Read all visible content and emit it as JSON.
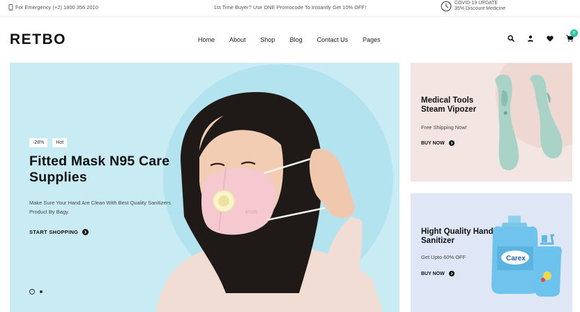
{
  "topbar": {
    "emergency": "For Emergency (+2) 1800 356 2010",
    "promo": "1st Time Buyer? Use ONE Promocode To Instantly Get 10% OFF!",
    "covid_title": "COVID-19 UPDATE",
    "covid_sub": "35% Discount Medicine"
  },
  "header": {
    "logo": "RETBO",
    "nav": [
      "Home",
      "About",
      "Shop",
      "Blog",
      "Contact Us",
      "Pages"
    ],
    "cart_count": "0",
    "icons": [
      "search-icon",
      "user-icon",
      "heart-icon",
      "cart-icon"
    ]
  },
  "hero": {
    "badge_discount": "-28%",
    "badge_hot": "Hot",
    "title": "Fitted Mask N95 Care Supplies",
    "description": "Make Sure Your Hand Are Clean With Best Quality Sanitizers Product By Bagy.",
    "cta": "START SHOPPING",
    "mask_text": "KN95",
    "slide_count": 2,
    "active_slide": 1
  },
  "banners": [
    {
      "title": "Medical Tools Steam Vipozer",
      "subtitle": "Free Shipping Now!",
      "cta": "BUY NOW"
    },
    {
      "title": "Hight Quality Hand Sanitizer",
      "subtitle": "Get Upto 60% OFF",
      "cta": "BUY NOW",
      "product_brand": "Carex"
    }
  ],
  "colors": {
    "hero_bg": "#c9ecf4",
    "banner1_bg": "#f3e5e1",
    "banner2_bg": "#dfe6f6",
    "accent": "#2ec4a0"
  }
}
